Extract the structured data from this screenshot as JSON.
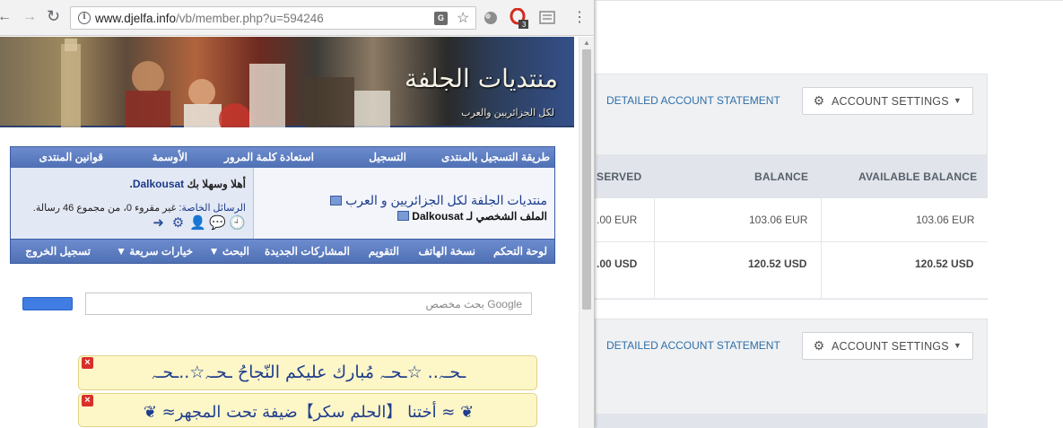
{
  "browser": {
    "url_host": "www.djelfa.info",
    "url_path": "/vb/member.php?u=594246",
    "extension_badge": "3"
  },
  "forum": {
    "top_nav": [
      "طريقة التسجيل بالمنتدى",
      "التسجيل",
      "استعادة كلمة المرور",
      "الأوسمة",
      "قوانين المنتدى"
    ],
    "welcome_prefix": "أهلا وسهلا بك",
    "username": "Dalkousat",
    "pm_label": "الرسائل الخاصة:",
    "pm_text": "غير مقروء 0، من مجموع 46 رسالة.",
    "forum_title": "منتديات الجلفة لكل الجزائريين و العرب",
    "profile_of": "الملف الشخصي لـ Dalkousat",
    "bottom_nav": [
      "لوحة التحكم",
      "نسخة الهاتف",
      "التقويم",
      "المشاركات الجديدة",
      "البحث ▼",
      "خيارات سريعة ▼",
      "تسجيل الخروج"
    ],
    "search_placeholder": "Google بحث مخصص",
    "announcements": [
      "ـحـﮧ.. ☆ـحـﮧ مُبارك عليكم النّجاحُ ـحـﮧ☆..ـحـﮧ",
      "❦ ≈ أختنا 【الحلم سكر】ضيفة تحت المجهر≈ ❦"
    ]
  },
  "account": {
    "statement_link": "DETAILED ACCOUNT STATEMENT",
    "settings_button": "ACCOUNT SETTINGS",
    "columns": [
      "SERVED",
      "BALANCE",
      "AVAILABLE BALANCE"
    ],
    "rows": [
      {
        "reserved": ".00 EUR",
        "balance": "103.06 EUR",
        "available": "103.06 EUR",
        "bold": false
      },
      {
        "reserved": ".00 USD",
        "balance": "120.52 USD",
        "available": "120.52 USD",
        "bold": true
      }
    ]
  },
  "colors": {
    "forum_nav": "#4f70b3",
    "link_blue": "#2e6fa8",
    "announcement_bg": "#fdf6c7"
  }
}
